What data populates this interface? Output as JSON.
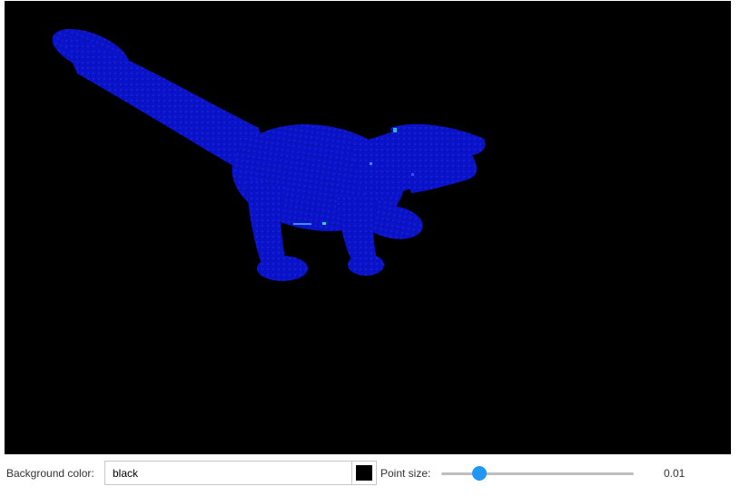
{
  "viewer": {
    "background": "#000000",
    "model_color": "#0b13c9",
    "highlight_color": "#27b8d8"
  },
  "controls": {
    "background_color_label": "Background color:",
    "background_color_value": "black",
    "swatch_color": "#000000",
    "point_size_label": "Point size:",
    "point_size_value": "0.01",
    "point_size_slider_fraction": 0.2,
    "accent_color": "#2196f3"
  }
}
